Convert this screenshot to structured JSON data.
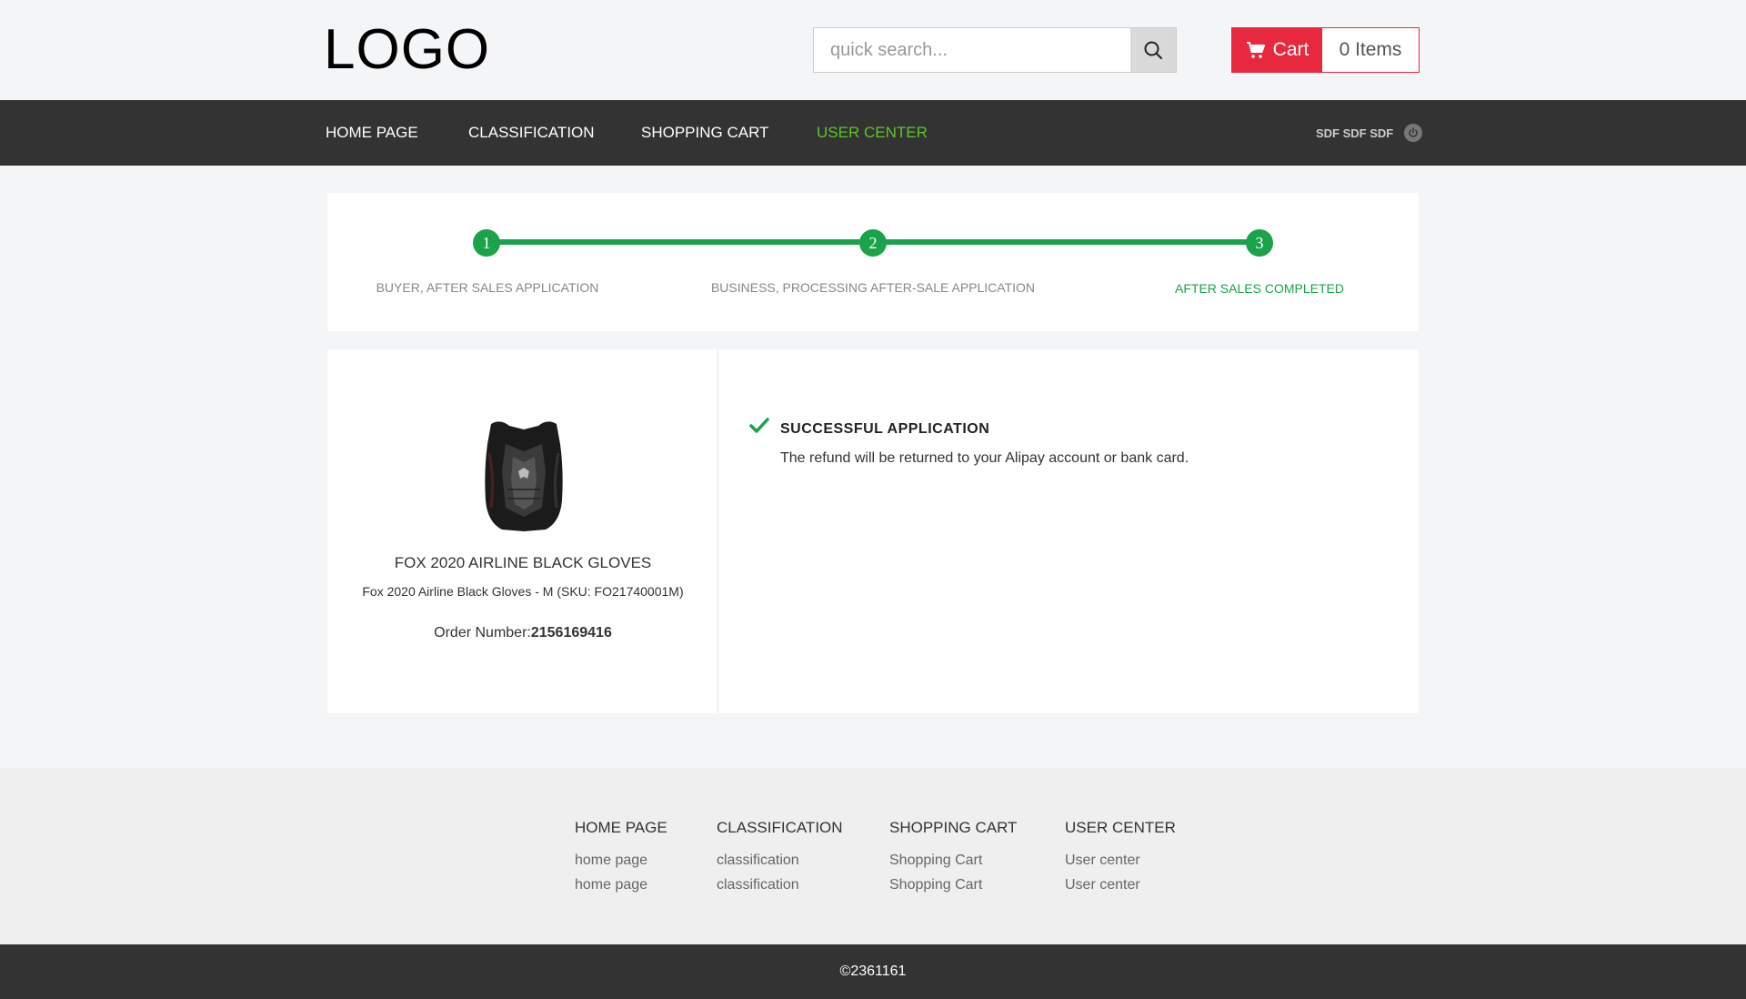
{
  "header": {
    "logo": "LOGO",
    "search_placeholder": "quick search...",
    "cart_label": "Cart",
    "cart_count": "0 Items"
  },
  "nav": {
    "items": [
      {
        "label": "HOME PAGE",
        "active": false
      },
      {
        "label": "CLASSIFICATION",
        "active": false
      },
      {
        "label": "SHOPPING CART",
        "active": false
      },
      {
        "label": "USER CENTER",
        "active": true
      }
    ],
    "username": "SDF SDF SDF"
  },
  "steps": [
    {
      "number": "1",
      "label": "BUYER, AFTER SALES APPLICATION"
    },
    {
      "number": "2",
      "label": "BUSINESS, PROCESSING AFTER-SALE APPLICATION"
    },
    {
      "number": "3",
      "label": "AFTER SALES COMPLETED"
    }
  ],
  "product": {
    "name": "FOX 2020 AIRLINE BLACK GLOVES",
    "sku": "Fox 2020 Airline Black Gloves - M (SKU: FO21740001M)",
    "order_label": "Order Number:",
    "order_number": "2156169416"
  },
  "result": {
    "title": "SUCCESSFUL APPLICATION",
    "message": "The refund will be returned to your Alipay account or bank card."
  },
  "footer": {
    "columns": [
      {
        "title": "HOME PAGE",
        "links": [
          "home page",
          "home page"
        ]
      },
      {
        "title": "CLASSIFICATION",
        "links": [
          "classification",
          "classification"
        ]
      },
      {
        "title": "SHOPPING CART",
        "links": [
          "Shopping Cart",
          "Shopping Cart"
        ]
      },
      {
        "title": "USER CENTER",
        "links": [
          "User center",
          "User center"
        ]
      }
    ],
    "copyright": "©2361161"
  },
  "colors": {
    "accent_green": "#1aa34a",
    "nav_active": "#5ec42b",
    "cart_red": "#e8283e",
    "nav_bg": "#333333"
  }
}
